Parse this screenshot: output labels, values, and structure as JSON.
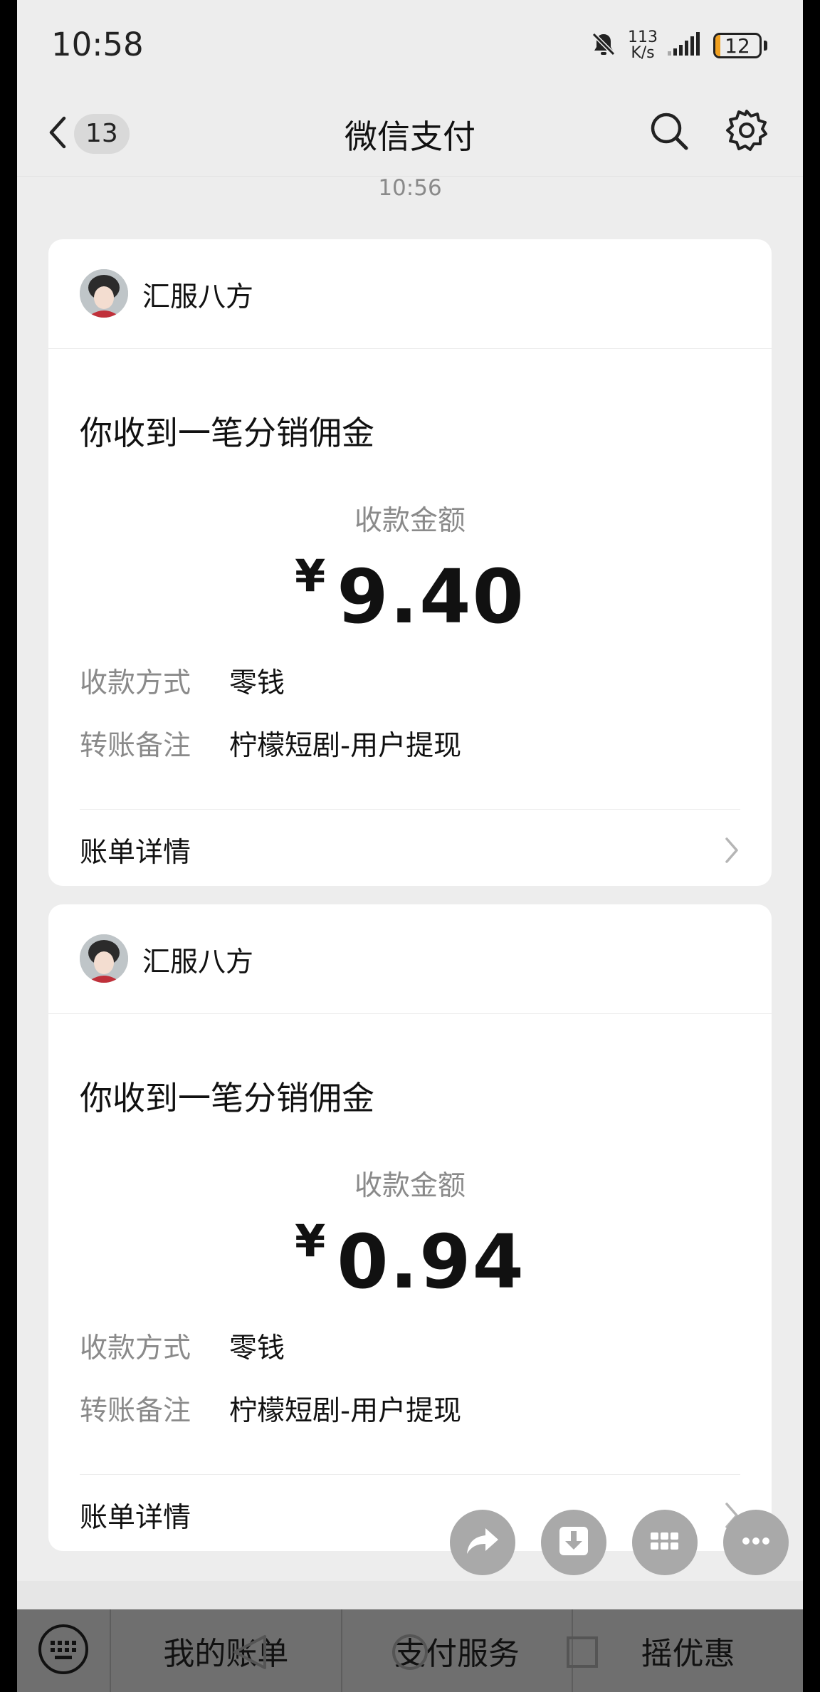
{
  "status_bar": {
    "time": "10:58",
    "net_speed_value": "113",
    "net_speed_unit": "K/s",
    "battery_level": "12",
    "battery_fraction": 0.12,
    "icons": [
      "mute-bell-icon",
      "signal-icon",
      "battery-icon"
    ]
  },
  "nav": {
    "unread_count": "13",
    "title": "微信支付",
    "icons": [
      "back-arrow-icon",
      "search-icon",
      "gear-icon"
    ]
  },
  "message_time": "10:56",
  "cards": [
    {
      "sender": "汇服八方",
      "title": "你收到一笔分销佣金",
      "amount_label": "收款金额",
      "currency": "¥",
      "amount": "9.40",
      "method_label": "收款方式",
      "method_value": "零钱",
      "note_label": "转账备注",
      "note_value": "柠檬短剧-用户提现",
      "bill_label": "账单详情"
    },
    {
      "sender": "汇服八方",
      "title": "你收到一笔分销佣金",
      "amount_label": "收款金额",
      "currency": "¥",
      "amount": "0.94",
      "method_label": "收款方式",
      "method_value": "零钱",
      "note_label": "转账备注",
      "note_value": "柠檬短剧-用户提现",
      "bill_label": "账单详情"
    }
  ],
  "floating_actions": [
    "share-icon",
    "download-icon",
    "grid-icon",
    "more-icon"
  ],
  "bottom_menu": {
    "items": [
      "我的账单",
      "支付服务",
      "摇优惠"
    ],
    "icons": [
      "keyboard-icon"
    ]
  },
  "system_nav": {
    "icons": [
      "back-triangle-icon",
      "home-circle-icon",
      "recents-square-icon"
    ]
  },
  "colors": {
    "background": "#ededed",
    "card": "#ffffff",
    "battery_low": "#f0a020",
    "bottom_menu": "#6f6f6f",
    "fab": "#a9a9a9"
  }
}
